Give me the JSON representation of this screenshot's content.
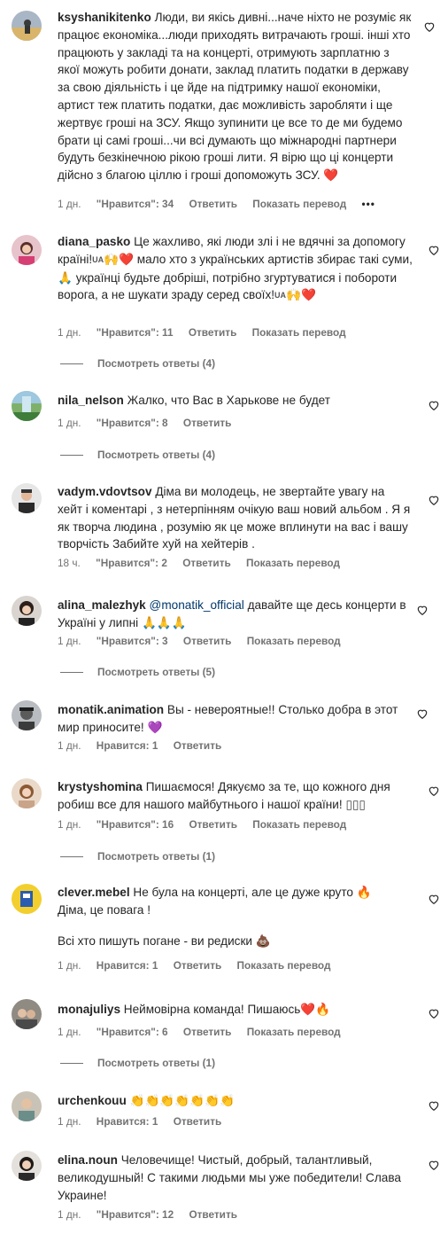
{
  "comments": [
    {
      "username": "ksyshanikitenko",
      "text": "Люди, ви якісь дивні...наче ніхто не розуміє як працює економіка...люди приходять витрачають гроші. інші хто працюють у закладі та на концерті, отримують зарплатню з якої можуть робити донати, заклад платить податки в державу за свою діяльність і це йде на підтримку нашої економіки, артист теж платить податки, дає можливість заробляти і ще жертвує гроші на ЗСУ. Якщо зупинити це все то де ми будемо брати ці самі гроші...чи всі думають що міжнародні партнери будуть безкінечною рікою гроші лити. Я вірю що ці концерти дійсно з благою ціллю і гроші допоможуть ЗСУ.",
      "emoji": "❤️",
      "time": "1 дн.",
      "likes": "\"Нравится\": 34",
      "reply": "Ответить",
      "translate": "Показать перевод",
      "more": "•••"
    },
    {
      "username": "diana_pasko",
      "text_a": "Це жахливо, які люди злі і не вдячні за допомогу країні!",
      "flag": "UA",
      "emoji_a": "🙌❤️",
      "text_b": "мало хто з українських артистів збирає такі суми,",
      "emoji_b": "🙏",
      "text_c": "українці будьте добріші, потрібно згуртуватися і побороти ворога, а не шукати зраду серед своїх!",
      "emoji_c": "🙌❤️",
      "time": "1 дн.",
      "likes": "\"Нравится\": 11",
      "reply": "Ответить",
      "translate": "Показать перевод",
      "replies": "Посмотреть ответы (4)"
    },
    {
      "username": "nila_nelson",
      "text": "Жалко, что Вас в Харькове не будет",
      "time": "1 дн.",
      "likes": "\"Нравится\": 8",
      "reply": "Ответить",
      "replies": "Посмотреть ответы (4)"
    },
    {
      "username": "vadym.vdovtsov",
      "text": "Діма ви молодець, не звертайте увагу на хейт і коментарі , з нетерпінням очікую ваш новий альбом . Я я як творча людина , розумію як це може вплинути на вас і вашу творчість Забийте хуй на хейтерів .",
      "time": "18 ч.",
      "likes": "\"Нравится\": 2",
      "reply": "Ответить",
      "translate": "Показать перевод"
    },
    {
      "username": "alina_malezhyk",
      "mention": "@monatik_official",
      "text": "давайте ще десь концерти в Україні у липні",
      "emoji": "🙏🙏🙏",
      "time": "1 дн.",
      "likes": "\"Нравится\": 3",
      "reply": "Ответить",
      "translate": "Показать перевод",
      "replies": "Посмотреть ответы (5)"
    },
    {
      "username": "monatik.animation",
      "text": "Вы - невероятные!! Столько добра в этот мир приносите!",
      "emoji": "💜",
      "time": "1 дн.",
      "likes": "Нравится: 1",
      "reply": "Ответить"
    },
    {
      "username": "krystyshomina",
      "text": "Пишаємося! Дякуємо за те, що кожного дня робиш все для нашого майбутнього і нашої країни!",
      "emoji": "▯▯▯",
      "time": "1 дн.",
      "likes": "\"Нравится\": 16",
      "reply": "Ответить",
      "translate": "Показать перевод",
      "replies": "Посмотреть ответы (1)"
    },
    {
      "username": "clever.mebel",
      "text": "Не була на концерті, але це дуже круто",
      "emoji": "🔥",
      "text_b": "Діма, це повага !",
      "text_c": "Всі хто пишуть погане - ви редиски",
      "emoji_c": "💩",
      "time": "1 дн.",
      "likes": "Нравится: 1",
      "reply": "Ответить",
      "translate": "Показать перевод"
    },
    {
      "username": "monajuliys",
      "text": "Неймовірна команда! Пишаюсь",
      "emoji": "❤️🔥",
      "time": "1 дн.",
      "likes": "\"Нравится\": 6",
      "reply": "Ответить",
      "translate": "Показать перевод",
      "replies": "Посмотреть ответы (1)"
    },
    {
      "username": "urchenkouu",
      "emoji": "👏👏👏👏👏👏👏",
      "time": "1 дн.",
      "likes": "Нравится: 1",
      "reply": "Ответить"
    },
    {
      "username": "elina.noun",
      "text": "Человечище! Чистый, добрый, талантливый, великодушный! С такими людьми мы уже победители! Слава Украине!",
      "time": "1 дн.",
      "likes": "\"Нравится\": 12",
      "reply": "Ответить"
    }
  ]
}
